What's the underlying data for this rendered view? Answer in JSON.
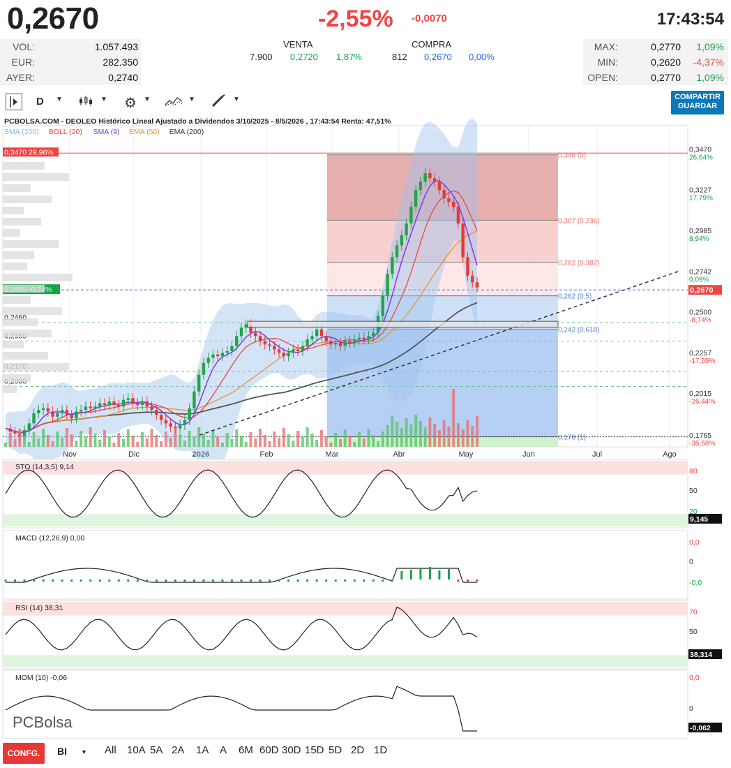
{
  "quote": {
    "price": "0,2670",
    "change_pct": "-2,55%",
    "change_abs": "-0,0070",
    "time": "17:43:54"
  },
  "stats_left": [
    {
      "label": "VOL:",
      "value": "1.057.493"
    },
    {
      "label": "EUR:",
      "value": "282.350"
    },
    {
      "label": "AYER:",
      "value": "0,2740"
    }
  ],
  "orderbook": {
    "venta_label": "VENTA",
    "compra_label": "COMPRA",
    "venta_qty": "7.900",
    "venta_price": "0,2720",
    "venta_pct": "1,87%",
    "compra_qty": "812",
    "compra_price": "0,2670",
    "compra_pct": "0,00%"
  },
  "stats_right": [
    {
      "label": "MAX:",
      "value": "0,2770",
      "pct": "1,09%",
      "color": "#16a34a"
    },
    {
      "label": "MIN:",
      "value": "0,2620",
      "pct": "-4,37%",
      "color": "#ef4444"
    },
    {
      "label": "OPEN:",
      "value": "0,2770",
      "pct": "1,09%",
      "color": "#16a34a"
    }
  ],
  "toolbar": {
    "period": "D",
    "share_label_1": "COMPARTIR",
    "share_label_2": "GUARDAR"
  },
  "chart_header": {
    "title": "PCBOLSA.COM - DEOLEO Histórico Lineal Ajustado a Dividendos 3/10/2025 - 8/5/2026 , 17:43:54 Renta: 47,51%",
    "legend": [
      {
        "label": "SMA (100)",
        "color": "#7fb3e6"
      },
      {
        "label": "BOLL (20)",
        "color": "#ef4444"
      },
      {
        "label": "SMA (9)",
        "color": "#7c3aed"
      },
      {
        "label": "EMA (50)",
        "color": "#e8913a"
      },
      {
        "label": "EMA (200)",
        "color": "#333333"
      }
    ]
  },
  "chart_data": {
    "type": "candlestick",
    "x_labels": [
      "Nov",
      "Dic",
      "2026",
      "Feb",
      "Mar",
      "Abr",
      "May",
      "Jun",
      "Jul",
      "Ago"
    ],
    "y_ticks": [
      {
        "value": "0,3470",
        "pct": "26,64%"
      },
      {
        "value": "0,3227",
        "pct": "17,79%"
      },
      {
        "value": "0,2985",
        "pct": "8,94%"
      },
      {
        "value": "0,2742",
        "pct": "0,09%"
      },
      {
        "value": "0,2500",
        "pct": "-8,74%"
      },
      {
        "value": "0,2257",
        "pct": "-17,59%"
      },
      {
        "value": "0,2015",
        "pct": "-26,44%"
      },
      {
        "value": "0,1765",
        "pct": "-35,58%"
      }
    ],
    "ylim": [
      0.172,
      0.365
    ],
    "last_price_label": "0,2670",
    "high_marker": {
      "price": "0,3470",
      "pct": "29,96%"
    },
    "ref_marker": {
      "price": "0,2650",
      "pct": "-0,74%"
    },
    "level_labels": [
      "0,2460",
      "0,2350",
      "0,2170",
      "0,2080"
    ],
    "fib_levels": [
      {
        "price": 0.346,
        "label": "0,346 (0)"
      },
      {
        "price": 0.307,
        "label": "0,307 (0.236)"
      },
      {
        "price": 0.282,
        "label": "0,282 (0.382)"
      },
      {
        "price": 0.262,
        "label": "0,262 (0.5)"
      },
      {
        "price": 0.242,
        "label": "0,242 (0.618)"
      },
      {
        "price": 0.178,
        "label": "0,178 (1)"
      }
    ],
    "close_series": [
      0.183,
      0.181,
      0.18,
      0.178,
      0.182,
      0.186,
      0.192,
      0.194,
      0.195,
      0.193,
      0.19,
      0.192,
      0.194,
      0.191,
      0.189,
      0.193,
      0.194,
      0.196,
      0.195,
      0.196,
      0.198,
      0.197,
      0.199,
      0.197,
      0.196,
      0.2,
      0.201,
      0.198,
      0.197,
      0.199,
      0.196,
      0.194,
      0.191,
      0.188,
      0.186,
      0.184,
      0.183,
      0.185,
      0.188,
      0.195,
      0.205,
      0.215,
      0.222,
      0.225,
      0.227,
      0.226,
      0.228,
      0.229,
      0.232,
      0.238,
      0.243,
      0.245,
      0.24,
      0.238,
      0.235,
      0.233,
      0.232,
      0.23,
      0.228,
      0.226,
      0.228,
      0.23,
      0.229,
      0.232,
      0.236,
      0.238,
      0.242,
      0.238,
      0.235,
      0.233,
      0.234,
      0.232,
      0.235,
      0.234,
      0.236,
      0.237,
      0.236,
      0.238,
      0.24,
      0.25,
      0.262,
      0.275,
      0.285,
      0.292,
      0.298,
      0.305,
      0.315,
      0.325,
      0.33,
      0.335,
      0.332,
      0.33,
      0.325,
      0.32,
      0.318,
      0.315,
      0.305,
      0.285,
      0.274,
      0.27,
      0.267
    ],
    "sto": {
      "label": "STO (14,3,5)",
      "value": "9,14",
      "last": "9,145",
      "levels": [
        "80",
        "50",
        "20"
      ]
    },
    "macd": {
      "label": "MACD (12,26,9)",
      "value": "0,00",
      "levels": [
        "0,0",
        "0",
        "-0,0"
      ]
    },
    "rsi": {
      "label": "RSI (14)",
      "value": "38,31",
      "last": "38,314",
      "levels": [
        "70",
        "50",
        "30"
      ]
    },
    "mom": {
      "label": "MOM (10)",
      "value": "-0,06",
      "last": "-0,062",
      "levels": [
        "0,0",
        "0"
      ]
    }
  },
  "watermark": "PCBolsa",
  "bottom": {
    "conf_label": "CONFG.",
    "chart_type": "BI",
    "ranges": [
      "All",
      "10A",
      "5A",
      "2A",
      "1A",
      "A",
      "6M",
      "60D",
      "30D",
      "15D",
      "5D",
      "2D",
      "1D"
    ]
  }
}
